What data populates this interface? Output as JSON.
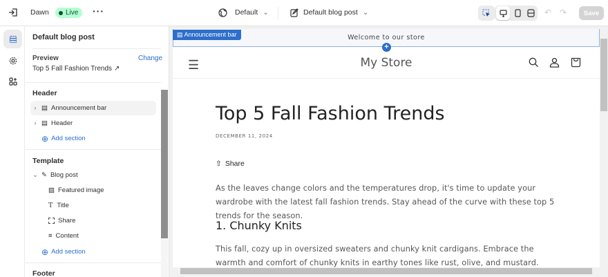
{
  "topbar": {
    "theme": "Dawn",
    "status": "Live",
    "locale": "Default",
    "template": "Default blog post",
    "save": "Save"
  },
  "sidebar": {
    "title": "Default blog post",
    "preview_label": "Preview",
    "change": "Change",
    "preview_value": "Top 5 Fall Fashion Trends",
    "header_group": "Header",
    "header_items": [
      "Announcement bar",
      "Header"
    ],
    "add_section": "Add section",
    "template_group": "Template",
    "blog_post": "Blog post",
    "blocks": [
      "Featured image",
      "Title",
      "Share",
      "Content"
    ],
    "footer_group": "Footer"
  },
  "preview": {
    "announcement_tag": "Announcement bar",
    "announcement": "Welcome to our store",
    "store": "My Store",
    "title": "Top 5 Fall Fashion Trends",
    "date": "DECEMBER 11, 2024",
    "share": "Share",
    "intro": "As the leaves change colors and the temperatures drop, it's time to update your wardrobe with the latest fall fashion trends. Stay ahead of the curve with these top 5 trends for the season.",
    "h2": "1. Chunky Knits",
    "p2": "This fall, cozy up in oversized sweaters and chunky knit cardigans. Embrace the warmth and comfort of chunky knits in earthy tones like rust, olive, and mustard. Pair them with your favorite"
  },
  "colors": {
    "accent": "#2c6ecb",
    "live_bg": "#b4fed2"
  }
}
